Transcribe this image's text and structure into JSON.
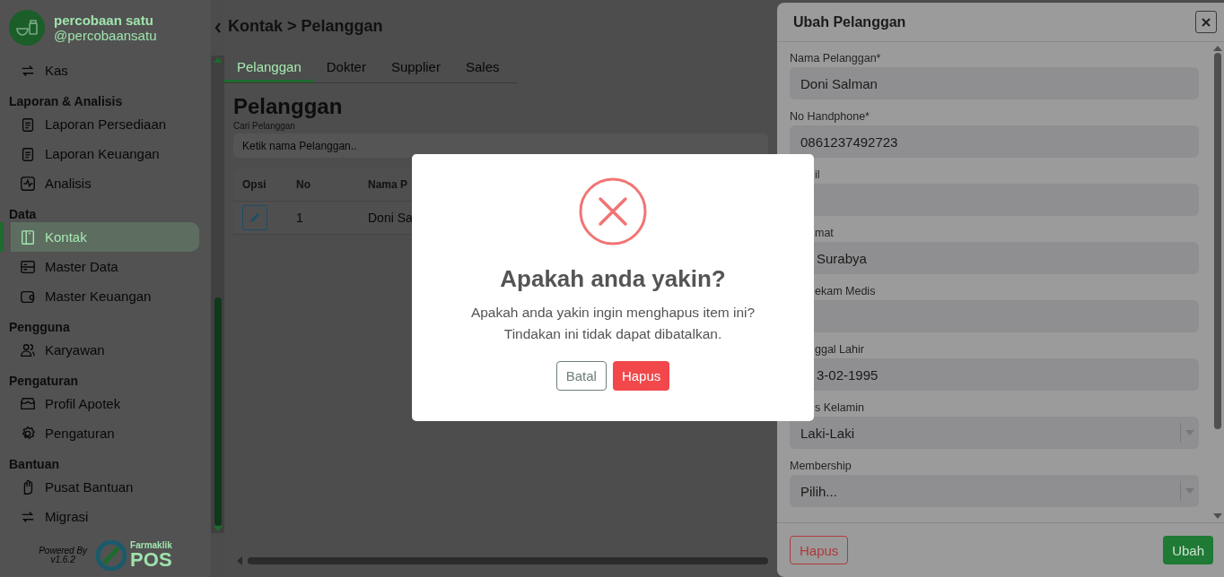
{
  "sidebar": {
    "brand": {
      "name": "percobaan satu",
      "handle": "@percobaansatu"
    },
    "sections": [
      {
        "items": [
          {
            "label": "Kas",
            "selected": false
          }
        ]
      },
      {
        "title": "Laporan & Analisis",
        "items": [
          {
            "label": "Laporan Persediaan",
            "selected": false
          },
          {
            "label": "Laporan Keuangan",
            "selected": false
          },
          {
            "label": "Analisis",
            "selected": false
          }
        ]
      },
      {
        "title": "Data",
        "items": [
          {
            "label": "Kontak",
            "selected": true
          },
          {
            "label": "Master Data",
            "selected": false
          },
          {
            "label": "Master Keuangan",
            "selected": false
          }
        ]
      },
      {
        "title": "Pengguna",
        "items": [
          {
            "label": "Karyawan",
            "selected": false
          }
        ]
      },
      {
        "title": "Pengaturan",
        "items": [
          {
            "label": "Profil Apotek",
            "selected": false
          },
          {
            "label": "Pengaturan",
            "selected": false
          }
        ]
      },
      {
        "title": "Bantuan",
        "items": [
          {
            "label": "Pusat Bantuan",
            "selected": false
          },
          {
            "label": "Migrasi",
            "selected": false
          }
        ]
      }
    ],
    "footer": {
      "powered_by": "Powered By",
      "version": "v1.6.2",
      "logo_top": "Farmaklik",
      "logo_bottom": "POS"
    }
  },
  "header": {
    "title": "Kontak > Pelanggan"
  },
  "tabs": [
    {
      "label": "Pelanggan",
      "selected": true
    },
    {
      "label": "Dokter",
      "selected": false
    },
    {
      "label": "Supplier",
      "selected": false
    },
    {
      "label": "Sales",
      "selected": false
    }
  ],
  "page": {
    "title": "Pelanggan",
    "search": {
      "label": "Cari Pelanggan",
      "placeholder": "Ketik nama Pelanggan.."
    },
    "table": {
      "columns": [
        "Opsi",
        "No",
        "Nama P"
      ],
      "rows": [
        {
          "no": "1",
          "name": "Doni Sa"
        }
      ]
    }
  },
  "edit_panel": {
    "title": "Ubah Pelanggan",
    "fields": [
      {
        "kind": "text",
        "label": "Nama Pelanggan*",
        "value": "Doni Salman",
        "covered": false
      },
      {
        "kind": "text",
        "label": "No Handphone*",
        "value": "0861237492723",
        "covered": false
      },
      {
        "kind": "text",
        "label": "il",
        "covered": true
      },
      {
        "kind": "text",
        "label": "mat",
        "value": "Surabya",
        "covered": true
      },
      {
        "kind": "text",
        "label": "ekam Medis",
        "covered": true
      },
      {
        "kind": "text",
        "label": "ggal Lahir",
        "value": "3-02-1995",
        "covered": true
      },
      {
        "kind": "select",
        "label": "s Kelamin",
        "value": "Laki-Laki",
        "covered": true
      },
      {
        "kind": "select",
        "label": "Membership",
        "value": "Pilih...",
        "covered": false
      }
    ],
    "delete_button": "Hapus",
    "save_button": "Ubah"
  },
  "dialog": {
    "title": "Apakah anda yakin?",
    "message": "Apakah anda yakin ingin menghapus item ini?\nTindakan ini tidak dapat dibatalkan.",
    "cancel_button": "Batal",
    "confirm_button": "Hapus"
  }
}
